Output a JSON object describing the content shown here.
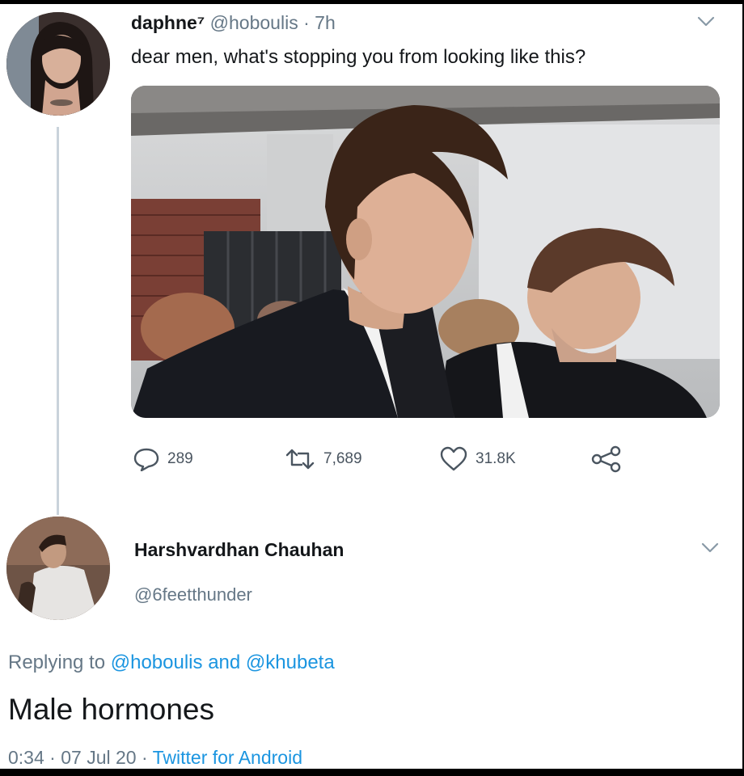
{
  "tweet": {
    "display_name": "daphne⁷",
    "handle": "@hoboulis",
    "separator": "·",
    "time": "7h",
    "text": "dear men, what's stopping you from looking like this?",
    "actions": {
      "replies": "289",
      "retweets": "7,689",
      "likes": "31.8K"
    }
  },
  "reply": {
    "display_name": "Harshvardhan Chauhan",
    "handle": "@6feetthunder",
    "replying_prefix": "Replying to",
    "replying_user1": "@hoboulis",
    "replying_and": "and",
    "replying_user2": "@khubeta",
    "text": "Male hormones",
    "time": "0:34",
    "date": "07 Jul 20",
    "dot": "·",
    "source": "Twitter for Android"
  },
  "icons": {
    "reply": "comment-bubble-icon",
    "retweet": "retweet-icon",
    "like": "heart-icon",
    "share": "share-icon",
    "more": "chevron-down-icon"
  },
  "colors": {
    "link": "#1b95e0",
    "secondary_text": "#657786",
    "thread_line": "#c9d3db"
  }
}
